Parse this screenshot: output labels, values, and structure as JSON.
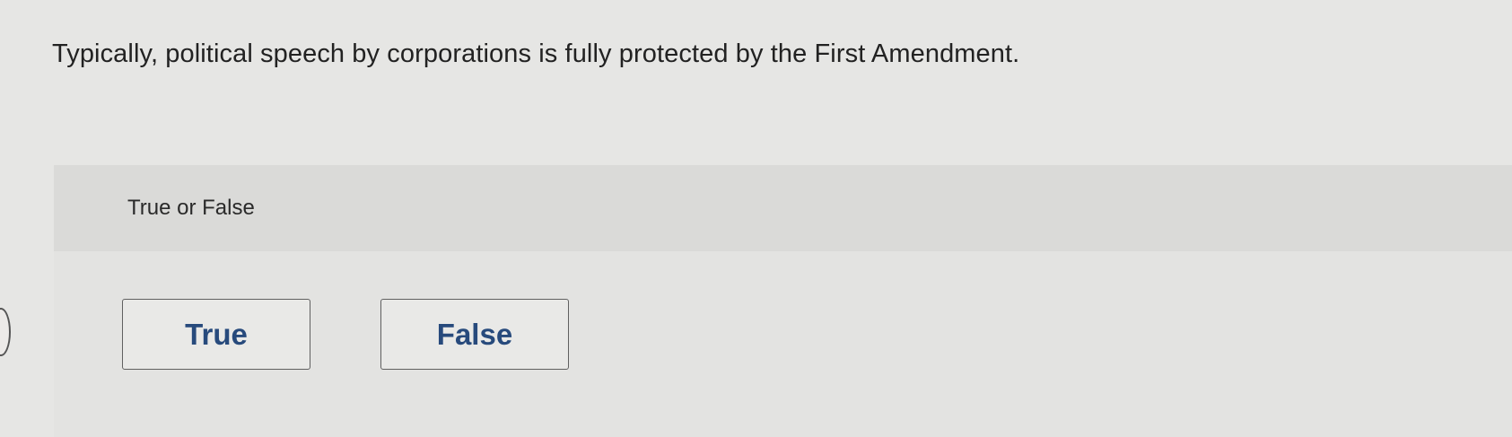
{
  "question": {
    "text": "Typically, political speech by corporations is fully protected by the First Amendment."
  },
  "prompt": {
    "type_label": "True or False"
  },
  "answers": [
    {
      "label": "True"
    },
    {
      "label": "False"
    }
  ],
  "colors": {
    "answer_text": "#274a7c",
    "band_background": "#dadad8",
    "page_background": "#e6e6e4"
  }
}
